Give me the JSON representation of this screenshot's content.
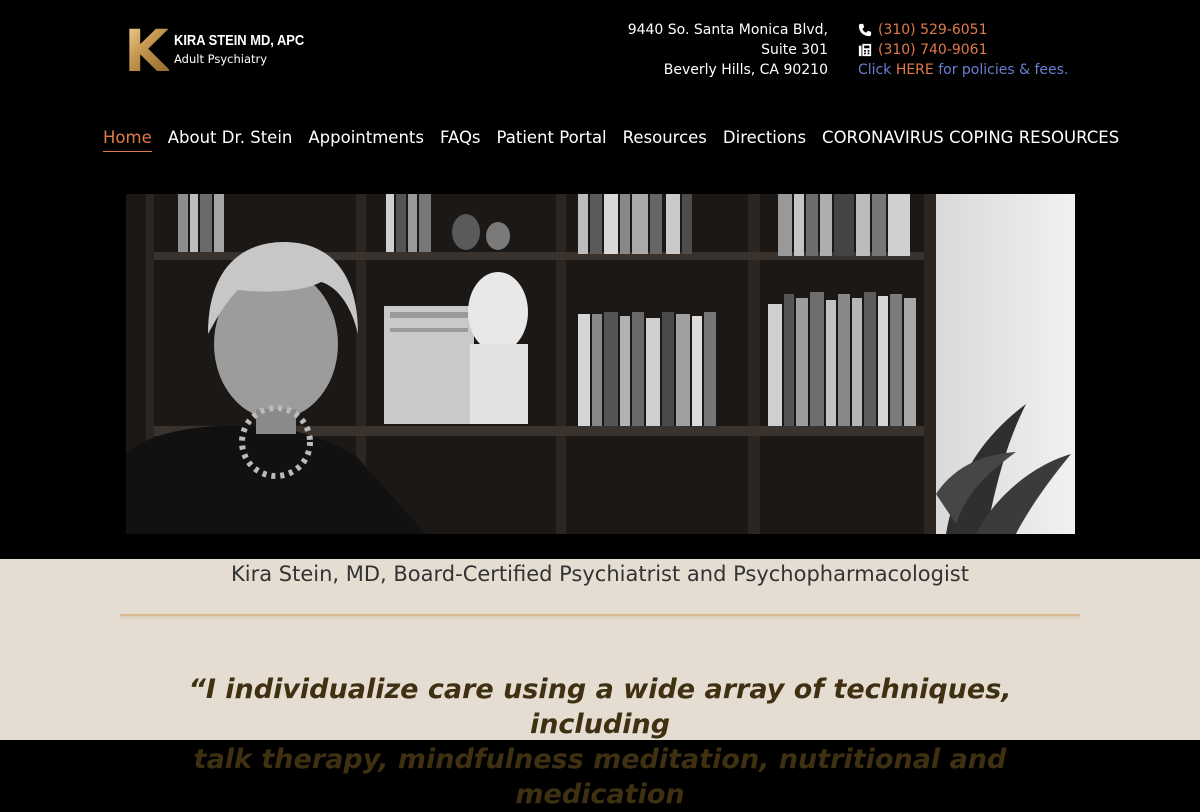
{
  "logo": {
    "letter": "K",
    "name": "KIRA STEIN MD, APC",
    "subtitle": "Adult Psychiatry"
  },
  "address": {
    "line1": "9440 So. Santa Monica Blvd,",
    "line2": "Suite 301",
    "line3": "Beverly Hills, CA 90210"
  },
  "contact": {
    "phone": "(310) 529-6051",
    "fax": "(310) 740-9061",
    "click_text": "Click",
    "here_text": "HERE",
    "policies_text": "for policies & fees."
  },
  "nav": {
    "items": [
      {
        "label": "Home",
        "active": true
      },
      {
        "label": "About Dr. Stein"
      },
      {
        "label": "Appointments"
      },
      {
        "label": "FAQs"
      },
      {
        "label": "Patient Portal"
      },
      {
        "label": "Resources"
      },
      {
        "label": "Directions"
      },
      {
        "label": "CORONAVIRUS COPING RESOURCES"
      }
    ]
  },
  "hero": {
    "caption": "Kira Stein, MD, Board-Certified Psychiatrist and Psychopharmacologist"
  },
  "quote": {
    "line1": "“I individualize care using a wide array of techniques, including",
    "line2": "talk therapy, mindfulness meditation, nutritional and medication"
  },
  "colors": {
    "accent": "#e07a4a",
    "link": "#6b7fd1",
    "band": "#e6ddd2",
    "quote": "#3f3012"
  }
}
